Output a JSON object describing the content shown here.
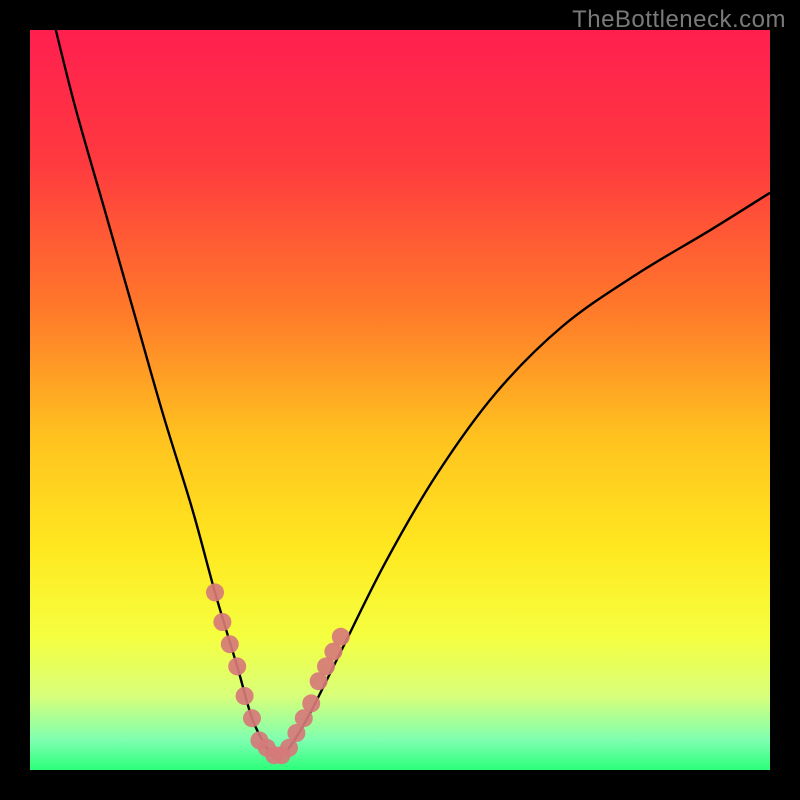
{
  "watermark": {
    "text": "TheBottleneck.com"
  },
  "colors": {
    "gradient_stops": [
      {
        "pct": 0,
        "color": "#ff1f4f"
      },
      {
        "pct": 18,
        "color": "#ff3a3f"
      },
      {
        "pct": 38,
        "color": "#ff7a2a"
      },
      {
        "pct": 55,
        "color": "#ffc21f"
      },
      {
        "pct": 70,
        "color": "#ffe81f"
      },
      {
        "pct": 82,
        "color": "#f5ff40"
      },
      {
        "pct": 90,
        "color": "#d8ff7a"
      },
      {
        "pct": 96,
        "color": "#7dffb0"
      },
      {
        "pct": 100,
        "color": "#2bff7a"
      }
    ],
    "curve": "#000000",
    "marker": "#d67a7a",
    "frame": "#000000"
  },
  "chart_data": {
    "type": "line",
    "title": "",
    "xlabel": "",
    "ylabel": "",
    "xlim": [
      0,
      100
    ],
    "ylim": [
      0,
      100
    ],
    "series": [
      {
        "name": "bottleneck-curve",
        "x": [
          3,
          6,
          10,
          14,
          18,
          22,
          25,
          28,
          30,
          32,
          33,
          35,
          38,
          42,
          48,
          55,
          63,
          72,
          82,
          92,
          100
        ],
        "values": [
          102,
          90,
          76,
          62,
          48,
          35,
          24,
          14,
          7,
          3,
          2,
          3,
          8,
          16,
          28,
          40,
          51,
          60,
          67,
          73,
          78
        ]
      }
    ],
    "markers": {
      "name": "highlighted-points",
      "x": [
        25,
        26,
        27,
        28,
        29,
        30,
        31,
        32,
        33,
        34,
        35,
        36,
        37,
        38,
        39,
        40,
        41,
        42
      ],
      "values": [
        24,
        20,
        17,
        14,
        10,
        7,
        4,
        3,
        2,
        2,
        3,
        5,
        7,
        9,
        12,
        14,
        16,
        18
      ]
    }
  }
}
